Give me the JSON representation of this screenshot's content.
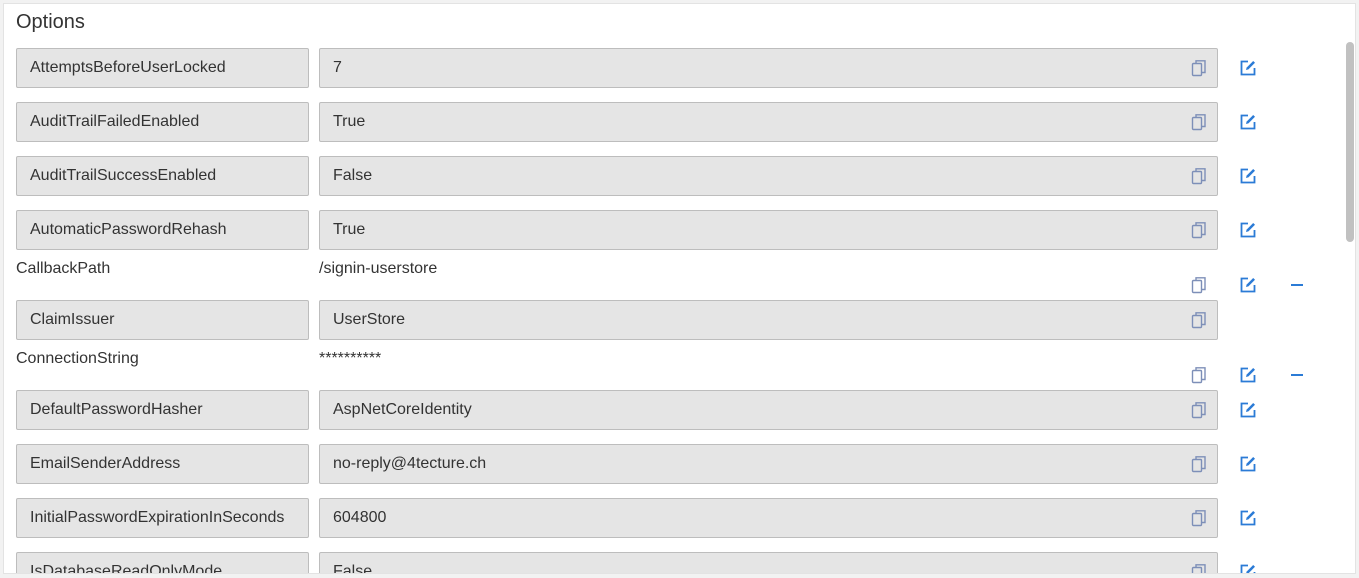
{
  "panel": {
    "title": "Options"
  },
  "colors": {
    "accent": "#2b7bd6",
    "copy_icon": "#7d8fb8",
    "field_bg": "#e5e5e5"
  },
  "icons": {
    "copy": "copy-icon",
    "edit": "edit-icon",
    "remove": "minus-icon"
  },
  "options": [
    {
      "key": "AttemptsBeforeUserLocked",
      "value": "7",
      "style": "boxed",
      "actions": [
        "copy",
        "edit"
      ]
    },
    {
      "key": "AuditTrailFailedEnabled",
      "value": "True",
      "style": "boxed",
      "actions": [
        "copy",
        "edit"
      ]
    },
    {
      "key": "AuditTrailSuccessEnabled",
      "value": "False",
      "style": "boxed",
      "actions": [
        "copy",
        "edit"
      ]
    },
    {
      "key": "AutomaticPasswordRehash",
      "value": "True",
      "style": "boxed",
      "actions": [
        "copy",
        "edit"
      ]
    },
    {
      "key": "CallbackPath",
      "value": "/signin-userstore",
      "style": "plain",
      "actions": [
        "copy",
        "edit",
        "remove"
      ]
    },
    {
      "key": "ClaimIssuer",
      "value": "UserStore",
      "style": "boxed",
      "actions": [
        "copy"
      ]
    },
    {
      "key": "ConnectionString",
      "value": "**********",
      "style": "plain",
      "actions": [
        "copy",
        "edit",
        "remove"
      ]
    },
    {
      "key": "DefaultPasswordHasher",
      "value": "AspNetCoreIdentity",
      "style": "boxed",
      "actions": [
        "copy",
        "edit"
      ]
    },
    {
      "key": "EmailSenderAddress",
      "value": "no-reply@4tecture.ch",
      "style": "boxed",
      "actions": [
        "copy",
        "edit"
      ]
    },
    {
      "key": "InitialPasswordExpirationInSeconds",
      "value": "604800",
      "style": "boxed",
      "actions": [
        "copy",
        "edit"
      ]
    },
    {
      "key": "IsDatabaseReadOnlyMode",
      "value": "False",
      "style": "boxed",
      "actions": [
        "copy",
        "edit"
      ]
    }
  ]
}
